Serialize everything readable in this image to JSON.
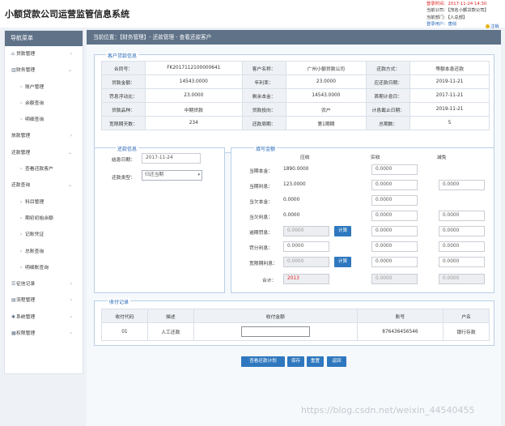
{
  "header": {
    "app_title": "小额贷款公司运营监管信息系统",
    "login_time": "登录时间：2017-11-24 14:30",
    "company": "当前公司：【茂名小额贷款公司】",
    "department": "当前部门：【人总部】",
    "user": "登录用户：唐俏",
    "logout": "注销"
  },
  "sidebar": {
    "title": "导航菜单",
    "items": [
      {
        "label": "贷款管理",
        "icon": "home-icon"
      },
      {
        "label": "财务管理",
        "icon": "bar-chart-icon"
      },
      {
        "label": "账户管理"
      },
      {
        "label": "余额查询"
      },
      {
        "label": "明细查询"
      },
      {
        "label": "放款管理"
      },
      {
        "label": "还款管理"
      },
      {
        "label": "查看还款客户"
      },
      {
        "label": "还款查询"
      },
      {
        "label": "科目管理"
      },
      {
        "label": "期初初始余额"
      },
      {
        "label": "记账凭证"
      },
      {
        "label": "总账查询"
      },
      {
        "label": "明细账查询"
      },
      {
        "label": "征信记录",
        "icon": "list-icon"
      },
      {
        "label": "流程管理",
        "icon": "flow-icon"
      },
      {
        "label": "系统管理",
        "icon": "gear-icon"
      },
      {
        "label": "权限管理",
        "icon": "grid-icon"
      }
    ]
  },
  "breadcrumb": "当前位置：【财务管理】- 还款管理 - 查看还款客户",
  "customer": {
    "legend": "客户贷款信息",
    "rows": [
      [
        "合同号：",
        "FK2017112100000641",
        "客户名称：",
        "广州小额贷款公司",
        "还款方式：",
        "等额本息还款"
      ],
      [
        "贷款金额：",
        "14543.0000",
        "年利率：",
        "23.0000",
        "应还款日期：",
        "2019-11-21"
      ],
      [
        "罚息浮动比：",
        "23.0000",
        "剩余本金：",
        "14543.0000",
        "首期计息日：",
        "2017-11-21"
      ],
      [
        "贷款品种：",
        "中期贷款",
        "贷款投向：",
        "农户",
        "计息截止日期：",
        "2019-11-21"
      ],
      [
        "宽限期天数：",
        "234",
        "还款周期：",
        "第1期期",
        "总期数：",
        "5"
      ]
    ]
  },
  "repay_info": {
    "legend": "还款信息",
    "date_label": "结息日期：",
    "date_value": "2017-11-24",
    "type_label": "还款类型：",
    "type_value": "归还当期"
  },
  "amount": {
    "legend": "填写金额",
    "col_due": "应收",
    "col_actual": "实收",
    "col_waive": "减免",
    "rows": [
      {
        "label": "当期本金：",
        "due": "1890.0000",
        "actual": "0.0000",
        "waive": ""
      },
      {
        "label": "当期利息：",
        "due": "123.0000",
        "actual": "0.0000",
        "waive": "0.0000"
      },
      {
        "label": "当欠本金：",
        "due": "0.0000",
        "actual": "0.0000",
        "waive": ""
      },
      {
        "label": "当欠利息：",
        "due": "0.0000",
        "actual": "0.0000",
        "waive": "0.0000"
      },
      {
        "label": "逾期罚息：",
        "due": "0.0000",
        "actual": "0.0000",
        "waive": "0.0000",
        "calc": "计算"
      },
      {
        "label": "罚分利息：",
        "due": "0.0000",
        "actual": "0.0000",
        "waive": "0.0000"
      },
      {
        "label": "宽限期利息：",
        "due": "0.0000",
        "actual": "0.0000",
        "waive": "0.0000",
        "calc": "计算"
      }
    ],
    "total_label": "合计：",
    "total_due": "2013",
    "total_actual": "0.0000",
    "total_waive": "0.0000"
  },
  "payment": {
    "legend": "收付记录",
    "headers": [
      "收付代码",
      "描述",
      "收付金额",
      "账号",
      "户名"
    ],
    "row": [
      "01",
      "人工还款",
      "",
      "876436456546",
      "银行存款"
    ]
  },
  "actions": {
    "view_plan": "查看还款计划",
    "save": "保存",
    "reset": "重置",
    "back": "返回"
  },
  "watermark": "https://blog.csdn.net/weixin_44540455"
}
